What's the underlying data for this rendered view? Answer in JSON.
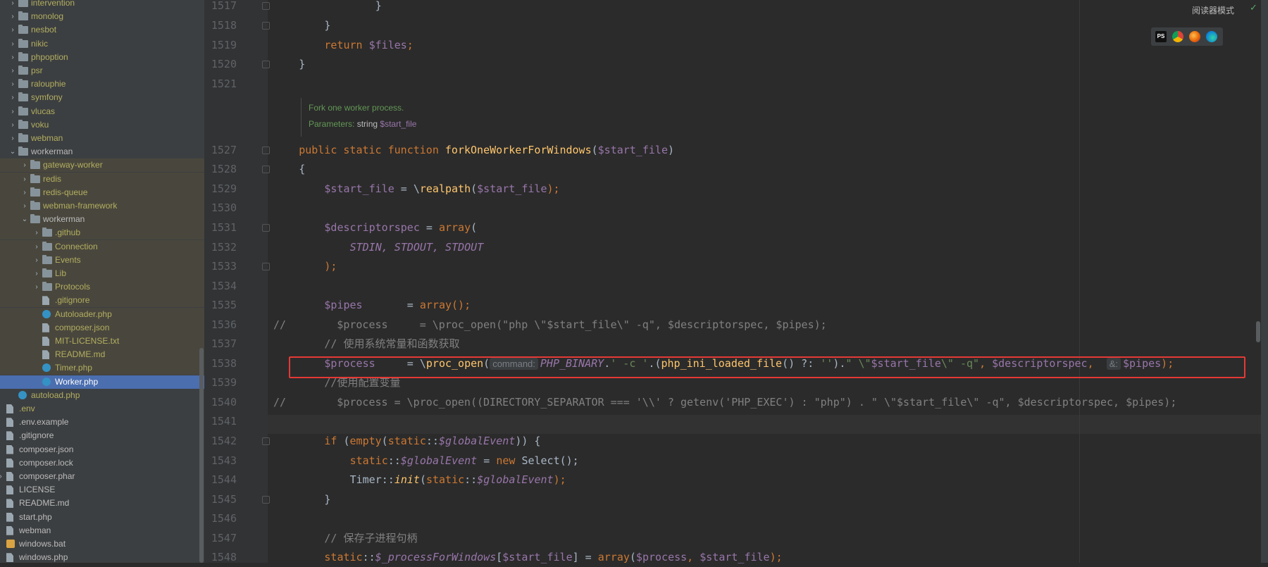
{
  "sidebar": {
    "rows": [
      {
        "label": "intervention",
        "type": "folder",
        "depth": 2,
        "arrow": "collapsed",
        "color": "yel",
        "hl": false,
        "sel": false
      },
      {
        "label": "monolog",
        "type": "folder",
        "depth": 2,
        "arrow": "collapsed",
        "color": "yel",
        "hl": false,
        "sel": false
      },
      {
        "label": "nesbot",
        "type": "folder",
        "depth": 2,
        "arrow": "collapsed",
        "color": "yel",
        "hl": false,
        "sel": false
      },
      {
        "label": "nikic",
        "type": "folder",
        "depth": 2,
        "arrow": "collapsed",
        "color": "yel",
        "hl": false,
        "sel": false
      },
      {
        "label": "phpoption",
        "type": "folder",
        "depth": 2,
        "arrow": "collapsed",
        "color": "yel",
        "hl": false,
        "sel": false
      },
      {
        "label": "psr",
        "type": "folder",
        "depth": 2,
        "arrow": "collapsed",
        "color": "yel",
        "hl": false,
        "sel": false
      },
      {
        "label": "ralouphie",
        "type": "folder",
        "depth": 2,
        "arrow": "collapsed",
        "color": "yel",
        "hl": false,
        "sel": false
      },
      {
        "label": "symfony",
        "type": "folder",
        "depth": 2,
        "arrow": "collapsed",
        "color": "yel",
        "hl": false,
        "sel": false
      },
      {
        "label": "vlucas",
        "type": "folder",
        "depth": 2,
        "arrow": "collapsed",
        "color": "yel",
        "hl": false,
        "sel": false
      },
      {
        "label": "voku",
        "type": "folder",
        "depth": 2,
        "arrow": "collapsed",
        "color": "yel",
        "hl": false,
        "sel": false
      },
      {
        "label": "webman",
        "type": "folder",
        "depth": 2,
        "arrow": "collapsed",
        "color": "yel",
        "hl": false,
        "sel": false
      },
      {
        "label": "workerman",
        "type": "folder",
        "depth": 2,
        "arrow": "expanded",
        "color": "wht",
        "hl": false,
        "sel": false
      },
      {
        "label": "gateway-worker",
        "type": "folder",
        "depth": 3,
        "arrow": "collapsed",
        "color": "yel",
        "hl": true,
        "sel": false
      },
      {
        "label": "redis",
        "type": "folder",
        "depth": 3,
        "arrow": "collapsed",
        "color": "yel",
        "hl": true,
        "sel": false
      },
      {
        "label": "redis-queue",
        "type": "folder",
        "depth": 3,
        "arrow": "collapsed",
        "color": "yel",
        "hl": true,
        "sel": false
      },
      {
        "label": "webman-framework",
        "type": "folder",
        "depth": 3,
        "arrow": "collapsed",
        "color": "yel",
        "hl": true,
        "sel": false
      },
      {
        "label": "workerman",
        "type": "folder",
        "depth": 3,
        "arrow": "expanded",
        "color": "wht",
        "hl": true,
        "sel": false
      },
      {
        "label": ".github",
        "type": "folder",
        "depth": 4,
        "arrow": "collapsed",
        "color": "yel",
        "hl": true,
        "sel": false
      },
      {
        "label": "Connection",
        "type": "folder",
        "depth": 4,
        "arrow": "collapsed",
        "color": "yel",
        "hl": true,
        "sel": false
      },
      {
        "label": "Events",
        "type": "folder",
        "depth": 4,
        "arrow": "collapsed",
        "color": "yel",
        "hl": true,
        "sel": false
      },
      {
        "label": "Lib",
        "type": "folder",
        "depth": 4,
        "arrow": "collapsed",
        "color": "yel",
        "hl": true,
        "sel": false
      },
      {
        "label": "Protocols",
        "type": "folder",
        "depth": 4,
        "arrow": "collapsed",
        "color": "yel",
        "hl": true,
        "sel": false
      },
      {
        "label": ".gitignore",
        "type": "file",
        "depth": 4,
        "arrow": "none",
        "color": "yel",
        "hl": true,
        "sel": false
      },
      {
        "label": "Autoloader.php",
        "type": "php",
        "depth": 4,
        "arrow": "none",
        "color": "yel",
        "hl": true,
        "sel": false
      },
      {
        "label": "composer.json",
        "type": "file",
        "depth": 4,
        "arrow": "none",
        "color": "yel",
        "hl": true,
        "sel": false
      },
      {
        "label": "MIT-LICENSE.txt",
        "type": "file",
        "depth": 4,
        "arrow": "none",
        "color": "yel",
        "hl": true,
        "sel": false
      },
      {
        "label": "README.md",
        "type": "file",
        "depth": 4,
        "arrow": "none",
        "color": "yel",
        "hl": true,
        "sel": false
      },
      {
        "label": "Timer.php",
        "type": "php",
        "depth": 4,
        "arrow": "none",
        "color": "yel",
        "hl": true,
        "sel": false
      },
      {
        "label": "Worker.php",
        "type": "php",
        "depth": 4,
        "arrow": "none",
        "color": "wht",
        "hl": false,
        "sel": true
      },
      {
        "label": "autoload.php",
        "type": "php",
        "depth": 2,
        "arrow": "none",
        "color": "yel",
        "hl": false,
        "sel": false
      },
      {
        "label": ".env",
        "type": "file",
        "depth": 1,
        "arrow": "none",
        "color": "yel",
        "hl": false,
        "sel": false
      },
      {
        "label": ".env.example",
        "type": "file",
        "depth": 1,
        "arrow": "none",
        "color": "wht",
        "hl": false,
        "sel": false
      },
      {
        "label": ".gitignore",
        "type": "file",
        "depth": 1,
        "arrow": "none",
        "color": "wht",
        "hl": false,
        "sel": false
      },
      {
        "label": "composer.json",
        "type": "file",
        "depth": 1,
        "arrow": "none",
        "color": "wht",
        "hl": false,
        "sel": false
      },
      {
        "label": "composer.lock",
        "type": "file",
        "depth": 1,
        "arrow": "none",
        "color": "wht",
        "hl": false,
        "sel": false
      },
      {
        "label": "composer.phar",
        "type": "file",
        "depth": 1,
        "arrow": "collapsed",
        "color": "wht",
        "hl": false,
        "sel": false
      },
      {
        "label": "LICENSE",
        "type": "file",
        "depth": 1,
        "arrow": "none",
        "color": "wht",
        "hl": false,
        "sel": false
      },
      {
        "label": "README.md",
        "type": "file",
        "depth": 1,
        "arrow": "none",
        "color": "wht",
        "hl": false,
        "sel": false
      },
      {
        "label": "start.php",
        "type": "file",
        "depth": 1,
        "arrow": "none",
        "color": "wht",
        "hl": false,
        "sel": false
      },
      {
        "label": "webman",
        "type": "file",
        "depth": 1,
        "arrow": "none",
        "color": "wht",
        "hl": false,
        "sel": false
      },
      {
        "label": "windows.bat",
        "type": "cfg",
        "depth": 1,
        "arrow": "none",
        "color": "wht",
        "hl": false,
        "sel": false
      },
      {
        "label": "windows.php",
        "type": "file",
        "depth": 1,
        "arrow": "none",
        "color": "wht",
        "hl": false,
        "sel": false
      }
    ]
  },
  "editor": {
    "doc": {
      "summary": "Fork one worker process.",
      "params_label": "Parameters:",
      "param_type": "string",
      "param_name": "$start_file"
    },
    "lines": [
      {
        "num": "1517",
        "indent": 16,
        "fold": true,
        "tokens": [
          {
            "t": "}",
            "c": ""
          }
        ]
      },
      {
        "num": "1518",
        "indent": 8,
        "fold": true,
        "tokens": [
          {
            "t": "}",
            "c": ""
          }
        ]
      },
      {
        "num": "1519",
        "indent": 8,
        "fold": false,
        "tokens": [
          {
            "t": "return ",
            "c": "kw"
          },
          {
            "t": "$files",
            "c": "vr"
          },
          {
            "t": ";",
            "c": "kw"
          }
        ]
      },
      {
        "num": "1520",
        "indent": 4,
        "fold": true,
        "tokens": [
          {
            "t": "}",
            "c": ""
          }
        ]
      },
      {
        "num": "1521",
        "indent": 0,
        "fold": false,
        "tokens": []
      },
      {
        "num": "1527",
        "indent": 4,
        "fold": true,
        "tokens": [
          {
            "t": "public static function ",
            "c": "kw"
          },
          {
            "t": "forkOneWorkerForWindows",
            "c": "fn"
          },
          {
            "t": "(",
            "c": ""
          },
          {
            "t": "$start_file",
            "c": "vr"
          },
          {
            "t": ")",
            "c": ""
          }
        ]
      },
      {
        "num": "1528",
        "indent": 4,
        "fold": true,
        "tokens": [
          {
            "t": "{",
            "c": ""
          }
        ]
      },
      {
        "num": "1529",
        "indent": 8,
        "fold": false,
        "tokens": [
          {
            "t": "$start_file",
            "c": "vr"
          },
          {
            "t": " = \\",
            "c": ""
          },
          {
            "t": "realpath",
            "c": "fn"
          },
          {
            "t": "(",
            "c": ""
          },
          {
            "t": "$start_file",
            "c": "vr"
          },
          {
            "t": ");",
            "c": "kw"
          }
        ]
      },
      {
        "num": "1530",
        "indent": 0,
        "fold": false,
        "tokens": []
      },
      {
        "num": "1531",
        "indent": 8,
        "fold": true,
        "tokens": [
          {
            "t": "$descriptorspec",
            "c": "vr"
          },
          {
            "t": " = ",
            "c": ""
          },
          {
            "t": "array",
            "c": "kw"
          },
          {
            "t": "(",
            "c": ""
          }
        ]
      },
      {
        "num": "1532",
        "indent": 12,
        "fold": false,
        "tokens": [
          {
            "t": "STDIN, STDOUT, STDOUT",
            "c": "vr it"
          }
        ]
      },
      {
        "num": "1533",
        "indent": 8,
        "fold": true,
        "tokens": [
          {
            "t": ");",
            "c": "kw"
          }
        ]
      },
      {
        "num": "1534",
        "indent": 0,
        "fold": false,
        "tokens": []
      },
      {
        "num": "1535",
        "indent": 8,
        "fold": false,
        "tokens": [
          {
            "t": "$pipes",
            "c": "vr"
          },
          {
            "t": "       = ",
            "c": ""
          },
          {
            "t": "array",
            "c": "kw"
          },
          {
            "t": "();",
            "c": "kw"
          }
        ]
      },
      {
        "num": "1536",
        "indent": 0,
        "fold": false,
        "tokens": [
          {
            "t": "//        $process     = \\proc_open(\"php \\\"$start_file\\\" -q\", $descriptorspec, $pipes);",
            "c": "cm"
          }
        ]
      },
      {
        "num": "1537",
        "indent": 8,
        "fold": false,
        "tokens": [
          {
            "t": "// 使用系统常量和函数获取",
            "c": "cm"
          }
        ]
      },
      {
        "num": "1538",
        "indent": 8,
        "fold": false,
        "tokens": [
          {
            "t": "$process",
            "c": "vr"
          },
          {
            "t": "     = \\",
            "c": ""
          },
          {
            "t": "proc_open",
            "c": "fn"
          },
          {
            "t": "(",
            "c": ""
          },
          {
            "t": "command:",
            "c": "hint"
          },
          {
            "t": "PHP_BINARY",
            "c": "vr it"
          },
          {
            "t": ".",
            "c": ""
          },
          {
            "t": "' -c '",
            "c": "st"
          },
          {
            "t": ".(",
            "c": ""
          },
          {
            "t": "php_ini_loaded_file",
            "c": "fn"
          },
          {
            "t": "() ?: ",
            "c": ""
          },
          {
            "t": "''",
            "c": "st"
          },
          {
            "t": ").",
            "c": ""
          },
          {
            "t": "\" \\\"",
            "c": "st"
          },
          {
            "t": "$start_file",
            "c": "vr"
          },
          {
            "t": "\\\" -q\"",
            "c": "st"
          },
          {
            "t": ", ",
            "c": "kw"
          },
          {
            "t": "$descriptorspec",
            "c": "vr"
          },
          {
            "t": ",  ",
            "c": "kw"
          },
          {
            "t": "&:",
            "c": "hint"
          },
          {
            "t": "$pipes",
            "c": "vr"
          },
          {
            "t": ");",
            "c": "kw"
          }
        ]
      },
      {
        "num": "1539",
        "indent": 8,
        "fold": false,
        "tokens": [
          {
            "t": "//使用配置变量",
            "c": "cm"
          }
        ]
      },
      {
        "num": "1540",
        "indent": 0,
        "fold": false,
        "tokens": [
          {
            "t": "//        $process = \\proc_open((DIRECTORY_SEPARATOR === '\\\\' ? getenv('PHP_EXEC') : \"php\") . \" \\\"$start_file\\\" -q\", $descriptorspec, $pipes);",
            "c": "cm"
          }
        ]
      },
      {
        "num": "1541",
        "indent": 0,
        "fold": false,
        "tokens": []
      },
      {
        "num": "1542",
        "indent": 8,
        "fold": true,
        "tokens": [
          {
            "t": "if ",
            "c": "kw"
          },
          {
            "t": "(",
            "c": ""
          },
          {
            "t": "empty",
            "c": "kw"
          },
          {
            "t": "(",
            "c": ""
          },
          {
            "t": "static",
            "c": "kw"
          },
          {
            "t": "::",
            "c": ""
          },
          {
            "t": "$globalEvent",
            "c": "vr it"
          },
          {
            "t": ")) {",
            "c": ""
          }
        ]
      },
      {
        "num": "1543",
        "indent": 12,
        "fold": false,
        "tokens": [
          {
            "t": "static",
            "c": "kw"
          },
          {
            "t": "::",
            "c": ""
          },
          {
            "t": "$globalEvent",
            "c": "vr it"
          },
          {
            "t": " = ",
            "c": ""
          },
          {
            "t": "new ",
            "c": "kw"
          },
          {
            "t": "Select();",
            "c": ""
          }
        ]
      },
      {
        "num": "1544",
        "indent": 12,
        "fold": false,
        "tokens": [
          {
            "t": "Timer::",
            "c": ""
          },
          {
            "t": "init",
            "c": "fn it"
          },
          {
            "t": "(",
            "c": ""
          },
          {
            "t": "static",
            "c": "kw"
          },
          {
            "t": "::",
            "c": ""
          },
          {
            "t": "$globalEvent",
            "c": "vr it"
          },
          {
            "t": ");",
            "c": "kw"
          }
        ]
      },
      {
        "num": "1545",
        "indent": 8,
        "fold": true,
        "tokens": [
          {
            "t": "}",
            "c": ""
          }
        ]
      },
      {
        "num": "1546",
        "indent": 0,
        "fold": false,
        "tokens": []
      },
      {
        "num": "1547",
        "indent": 8,
        "fold": false,
        "tokens": [
          {
            "t": "// 保存子进程句柄",
            "c": "cm"
          }
        ]
      },
      {
        "num": "1548",
        "indent": 8,
        "fold": false,
        "tokens": [
          {
            "t": "static",
            "c": "kw"
          },
          {
            "t": "::",
            "c": ""
          },
          {
            "t": "$_processForWindows",
            "c": "vr it"
          },
          {
            "t": "[",
            "c": ""
          },
          {
            "t": "$start_file",
            "c": "vr"
          },
          {
            "t": "] = ",
            "c": ""
          },
          {
            "t": "array",
            "c": "kw"
          },
          {
            "t": "(",
            "c": ""
          },
          {
            "t": "$process",
            "c": "vr"
          },
          {
            "t": ", ",
            "c": "kw"
          },
          {
            "t": "$start_file",
            "c": "vr"
          },
          {
            "t": ");",
            "c": "kw"
          }
        ]
      }
    ]
  },
  "toolbar": {
    "reader_mode": "阅读器模式",
    "ps_label": "PS"
  },
  "icons": {
    "browsers": [
      "phpstorm-icon",
      "chrome-icon",
      "firefox-icon",
      "edge-icon"
    ]
  }
}
